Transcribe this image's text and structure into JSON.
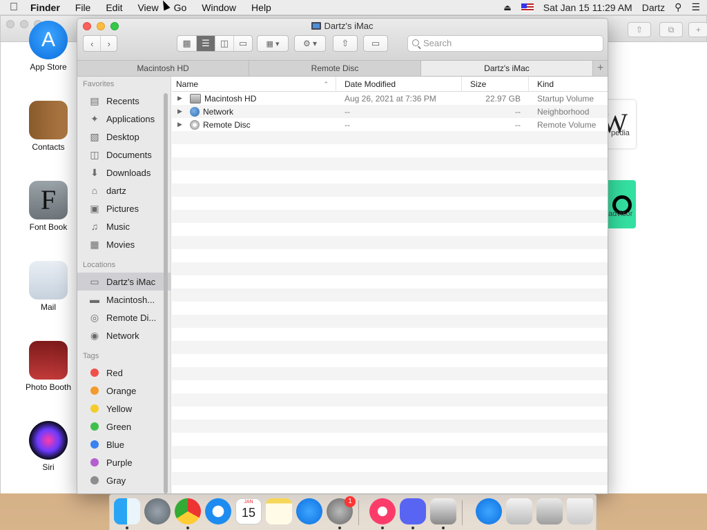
{
  "menubar": {
    "app": "Finder",
    "menus": [
      "File",
      "Edit",
      "View",
      "Go",
      "Window",
      "Help"
    ],
    "clock": "Sat Jan 15  11:29 AM",
    "user": "Dartz"
  },
  "desktop_icons": [
    {
      "label": "App Store",
      "icon": "app-store-icon"
    },
    {
      "label": "Contacts",
      "icon": "contacts-icon"
    },
    {
      "label": "Font Book",
      "icon": "font-book-icon"
    },
    {
      "label": "Mail",
      "icon": "mail-icon"
    },
    {
      "label": "Photo Booth",
      "icon": "photo-booth-icon"
    },
    {
      "label": "Siri",
      "icon": "siri-icon"
    }
  ],
  "background_window": {
    "tile_labels": [
      "pedia",
      "advisor"
    ]
  },
  "finder": {
    "title": "Dartz's iMac",
    "search_placeholder": "Search",
    "tabs": [
      {
        "label": "Macintosh HD",
        "active": false
      },
      {
        "label": "Remote Disc",
        "active": false
      },
      {
        "label": "Dartz's iMac",
        "active": true
      }
    ],
    "sidebar": {
      "favorites_heading": "Favorites",
      "favorites": [
        {
          "label": "Recents",
          "icon": "recents-icon"
        },
        {
          "label": "Applications",
          "icon": "applications-icon"
        },
        {
          "label": "Desktop",
          "icon": "desktop-icon"
        },
        {
          "label": "Documents",
          "icon": "documents-icon"
        },
        {
          "label": "Downloads",
          "icon": "downloads-icon"
        },
        {
          "label": "dartz",
          "icon": "home-icon"
        },
        {
          "label": "Pictures",
          "icon": "pictures-icon"
        },
        {
          "label": "Music",
          "icon": "music-icon"
        },
        {
          "label": "Movies",
          "icon": "movies-icon"
        }
      ],
      "locations_heading": "Locations",
      "locations": [
        {
          "label": "Dartz's iMac",
          "icon": "computer-icon",
          "selected": true
        },
        {
          "label": "Macintosh...",
          "icon": "hard-drive-icon",
          "selected": false
        },
        {
          "label": "Remote Di...",
          "icon": "disc-icon",
          "selected": false
        },
        {
          "label": "Network",
          "icon": "network-icon",
          "selected": false
        }
      ],
      "tags_heading": "Tags",
      "tags": [
        {
          "label": "Red",
          "color": "#f0504a"
        },
        {
          "label": "Orange",
          "color": "#f39a2c"
        },
        {
          "label": "Yellow",
          "color": "#f5cc2b"
        },
        {
          "label": "Green",
          "color": "#3fbf4b"
        },
        {
          "label": "Blue",
          "color": "#3a82f0"
        },
        {
          "label": "Purple",
          "color": "#b45ecf"
        },
        {
          "label": "Gray",
          "color": "#8e8e92"
        }
      ]
    },
    "columns": {
      "name": "Name",
      "date": "Date Modified",
      "size": "Size",
      "kind": "Kind"
    },
    "rows": [
      {
        "name": "Macintosh HD",
        "date": "Aug 26, 2021 at 7:36 PM",
        "size": "22.97 GB",
        "kind": "Startup Volume",
        "icon": "hard-drive-icon"
      },
      {
        "name": "Network",
        "date": "--",
        "size": "--",
        "kind": "Neighborhood",
        "icon": "network-globe-icon"
      },
      {
        "name": "Remote Disc",
        "date": "--",
        "size": "--",
        "kind": "Remote Volume",
        "icon": "remote-disc-icon"
      }
    ]
  },
  "dock": {
    "items": [
      "finder-icon",
      "launchpad-icon",
      "chrome-icon",
      "safari-icon",
      "calendar-icon",
      "notes-icon",
      "app-store-icon",
      "system-preferences-icon",
      "music-icon",
      "discord-icon",
      "archive-utility-icon",
      "app-store-downloads-icon",
      "preview-icon",
      "screenshot-icon",
      "trash-icon"
    ],
    "calendar_day": "15",
    "calendar_month": "JAN",
    "badge": "1"
  }
}
